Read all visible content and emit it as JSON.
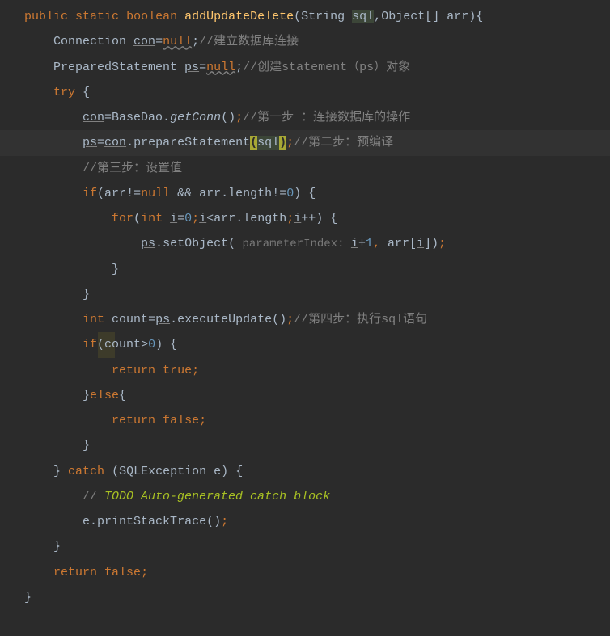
{
  "code": {
    "l1": {
      "kw1": "public",
      "kw2": "static",
      "kw3": "boolean",
      "method": "addUpdateDelete",
      "p1": "(",
      "t1": "String ",
      "arg1": "sql",
      "c1": ",",
      "t2": "Object",
      "br": "[]",
      "sp": " ",
      "arg2": "arr",
      "p2": ")",
      "b": "{"
    },
    "l2": {
      "indent": "    ",
      "t": "Connection ",
      "v": "con",
      "eq": "=",
      "kw": "null",
      "sc": ";",
      "cm": "//建立数据库连接"
    },
    "l3": {
      "indent": "    ",
      "t": "PreparedStatement ",
      "v": "ps",
      "eq": "=",
      "kw": "null",
      "sc": ";",
      "cm": "//创建statement（ps）对象"
    },
    "l4": {
      "indent": "    ",
      "kw": "try",
      "sp": " ",
      "b": "{"
    },
    "l5": {
      "indent": "        ",
      "v": "con",
      "eq": "=",
      "cls": "BaseDao.",
      "m": "getConn",
      "p": "()",
      "sc": ";",
      "cm": "//第一步 ：连接数据库的操作"
    },
    "l6": {
      "indent": "        ",
      "v": "ps",
      "eq": "=",
      "v2": "con",
      "dot": ".",
      "m": "prepareStatement",
      "p1": "(",
      "arg": "sql",
      "p2": ")",
      "sc": ";",
      "cm": "//第二步：预编译"
    },
    "l7": {
      "indent": "        ",
      "cm": "//第三步：设置值"
    },
    "l8": {
      "indent": "        ",
      "kw": "if",
      "p1": "(",
      "v": "arr",
      "ne": "!=",
      "kw2": "null",
      "sp": " ",
      "op": "&&",
      "sp2": " ",
      "v2": "arr",
      "dot": ".",
      "prop": "length",
      "ne2": "!=",
      "n": "0",
      "p2": ")",
      "sp3": " ",
      "b": "{"
    },
    "l9": {
      "indent": "            ",
      "kw": "for",
      "p1": "(",
      "kw2": "int",
      "sp": " ",
      "v": "i",
      "eq": "=",
      "n": "0",
      "sc": ";",
      "v2": "i",
      "lt": "<",
      "v3": "arr",
      "dot": ".",
      "prop": "length",
      "sc2": ";",
      "v4": "i",
      "inc": "++",
      "p2": ")",
      "sp2": " ",
      "b": "{"
    },
    "l10": {
      "indent": "                ",
      "v": "ps",
      "dot": ".",
      "m": "setObject",
      "p1": "(",
      "hint": " parameterIndex: ",
      "v2": "i",
      "plus": "+",
      "n": "1",
      "c": ", ",
      "v3": "arr",
      "br1": "[",
      "v4": "i",
      "br2": "]",
      "p2": ")",
      "sc": ";"
    },
    "l11": {
      "indent": "            ",
      "b": "}"
    },
    "l12": {
      "indent": "        ",
      "b": "}"
    },
    "l13": {
      "indent": "        ",
      "kw": "int",
      "sp": " ",
      "v": "count",
      "eq": "=",
      "v2": "ps",
      "dot": ".",
      "m": "executeUpdate",
      "p": "()",
      "sc": ";",
      "cm": "//第四步：执行sql语句"
    },
    "l14": {
      "indent": "        ",
      "kw": "if",
      "p1": "(",
      "v": "count",
      "gt": ">",
      "n": "0",
      "p2": ")",
      "sp": " ",
      "b": "{"
    },
    "l15": {
      "indent": "            ",
      "kw": "return",
      "sp": " ",
      "kw2": "true",
      "sc": ";"
    },
    "l16": {
      "indent": "        ",
      "b": "}",
      "kw": "else",
      "b2": "{"
    },
    "l17": {
      "indent": "            ",
      "kw": "return",
      "sp": " ",
      "kw2": "false",
      "sc": ";"
    },
    "l18": {
      "indent": "        ",
      "b": "}"
    },
    "l19": {
      "indent": "    ",
      "b": "}",
      "sp": " ",
      "kw": "catch",
      "sp2": " ",
      "p1": "(",
      "t": "SQLException",
      "sp3": " ",
      "v": "e",
      "p2": ")",
      "sp4": " ",
      "b2": "{"
    },
    "l20": {
      "indent": "        ",
      "cm": "// ",
      "todo": "TODO Auto-generated catch block"
    },
    "l21": {
      "indent": "        ",
      "v": "e",
      "dot": ".",
      "m": "printStackTrace",
      "p": "()",
      "sc": ";"
    },
    "l22": {
      "indent": "    ",
      "b": "}"
    },
    "l23": {
      "indent": "    ",
      "kw": "return",
      "sp": " ",
      "kw2": "false",
      "sc": ";"
    },
    "l24": {
      "b": "}"
    }
  }
}
